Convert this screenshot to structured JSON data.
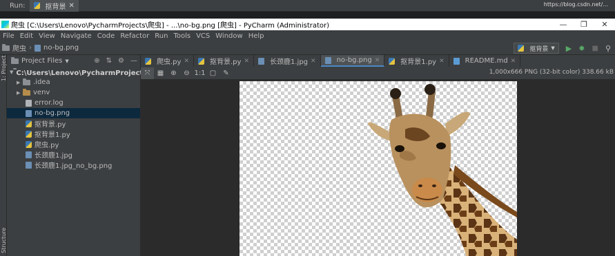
{
  "run_strip": {
    "label": "Run:",
    "tab": "抠背景",
    "url": "https://blog.csdn.net/..."
  },
  "window": {
    "title": "爬虫 [C:\\Users\\Lenovo\\PycharmProjects\\爬虫] - ...\\no-bg.png [爬虫] - PyCharm (Administrator)",
    "controls": {
      "minimize": "—",
      "maximize": "❐",
      "close": "✕"
    }
  },
  "menu": [
    "File",
    "Edit",
    "View",
    "Navigate",
    "Code",
    "Refactor",
    "Run",
    "Tools",
    "VCS",
    "Window",
    "Help"
  ],
  "navbar": {
    "project": "爬虫",
    "file": "no-bg.png",
    "run_config": "抠背景"
  },
  "project_panel": {
    "header": "Project Files",
    "root": "C:\\Users\\Lenovo\\PycharmProjects\\爬虫",
    "items": [
      {
        "label": ".idea",
        "type": "folder"
      },
      {
        "label": "venv",
        "type": "folder"
      },
      {
        "label": "error.log",
        "type": "text"
      },
      {
        "label": "no-bg.png",
        "type": "png",
        "selected": true
      },
      {
        "label": "抠背景.py",
        "type": "py"
      },
      {
        "label": "抠背景1.py",
        "type": "py"
      },
      {
        "label": "爬虫.py",
        "type": "py"
      },
      {
        "label": "长颈鹿1.jpg",
        "type": "jpg"
      },
      {
        "label": "长颈鹿1.jpg_no_bg.png",
        "type": "png"
      }
    ]
  },
  "side_labels": {
    "project": "1: Project",
    "structure": "Structure"
  },
  "tabs": [
    {
      "label": "爬虫.py",
      "icon": "python-file-icon"
    },
    {
      "label": "抠背景.py",
      "icon": "python-file-icon"
    },
    {
      "label": "长颈鹿1.jpg",
      "icon": "image-file-icon"
    },
    {
      "label": "no-bg.png",
      "icon": "image-file-icon",
      "active": true
    },
    {
      "label": "抠背景1.py",
      "icon": "python-file-icon"
    },
    {
      "label": "README.md",
      "icon": "markdown-file-icon"
    }
  ],
  "image_info": "1,000x666 PNG (32-bit color) 338.66 kB",
  "colors": {
    "accent": "#4a88c7",
    "selection": "#0d293e",
    "panel": "#3c3f41",
    "editor": "#2b2b2b"
  }
}
